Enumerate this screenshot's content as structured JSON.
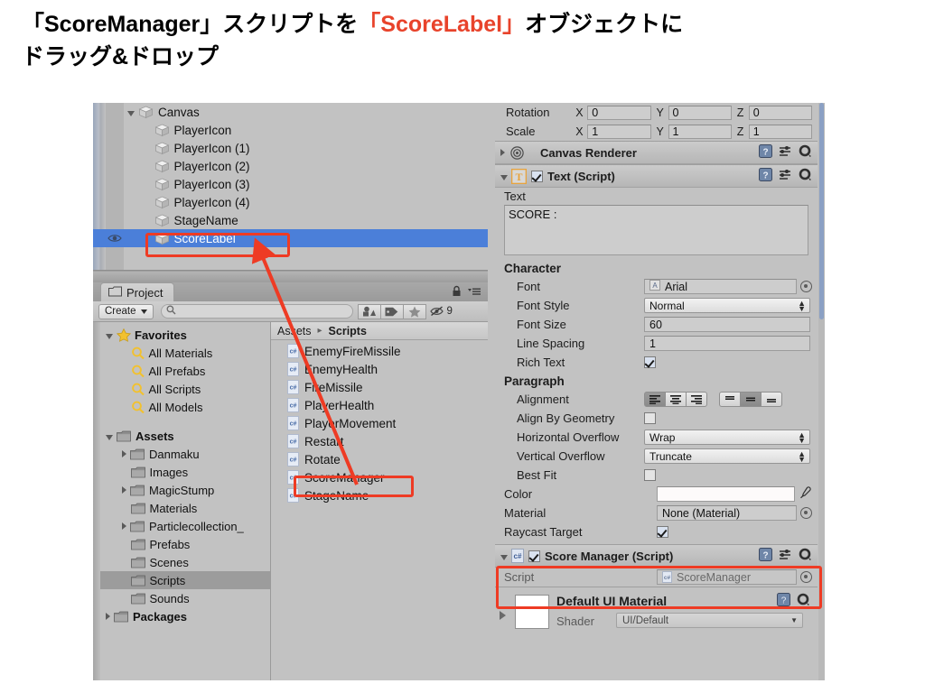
{
  "caption": {
    "line1_pre": "「ScoreManager」スクリプトを",
    "line1_hl": "「ScoreLabel」",
    "line1_post": "オブジェクトに",
    "line2": "ドラッグ&ドロップ"
  },
  "hierarchy": {
    "items": [
      {
        "label": "Canvas",
        "indent": 1,
        "expanded": true,
        "selected": false,
        "eye": false
      },
      {
        "label": "PlayerIcon",
        "indent": 2,
        "expanded": false,
        "selected": false,
        "eye": false
      },
      {
        "label": "PlayerIcon (1)",
        "indent": 2,
        "expanded": false,
        "selected": false,
        "eye": false
      },
      {
        "label": "PlayerIcon (2)",
        "indent": 2,
        "expanded": false,
        "selected": false,
        "eye": false
      },
      {
        "label": "PlayerIcon (3)",
        "indent": 2,
        "expanded": false,
        "selected": false,
        "eye": false
      },
      {
        "label": "PlayerIcon (4)",
        "indent": 2,
        "expanded": false,
        "selected": false,
        "eye": false
      },
      {
        "label": "StageName",
        "indent": 2,
        "expanded": false,
        "selected": false,
        "eye": false
      },
      {
        "label": "ScoreLabel",
        "indent": 2,
        "expanded": false,
        "selected": true,
        "eye": true
      }
    ]
  },
  "project": {
    "tab_label": "Project",
    "create_label": "Create",
    "search_placeholder": "",
    "hidden_count": "9",
    "breadcrumb": {
      "root": "Assets",
      "current": "Scripts"
    },
    "tree": [
      {
        "label": "Favorites",
        "kind": "favorites",
        "indent": 0,
        "expanded": true,
        "bold": true,
        "selected": false
      },
      {
        "label": "All Materials",
        "kind": "search",
        "indent": 1,
        "expanded": null,
        "bold": false,
        "selected": false
      },
      {
        "label": "All Prefabs",
        "kind": "search",
        "indent": 1,
        "expanded": null,
        "bold": false,
        "selected": false
      },
      {
        "label": "All Scripts",
        "kind": "search",
        "indent": 1,
        "expanded": null,
        "bold": false,
        "selected": false
      },
      {
        "label": "All Models",
        "kind": "search",
        "indent": 1,
        "expanded": null,
        "bold": false,
        "selected": false
      },
      {
        "label": "",
        "kind": "spacer",
        "indent": 0,
        "expanded": null,
        "bold": false,
        "selected": false
      },
      {
        "label": "Assets",
        "kind": "folder",
        "indent": 0,
        "expanded": true,
        "bold": true,
        "selected": false
      },
      {
        "label": "Danmaku",
        "kind": "folder",
        "indent": 1,
        "expanded": false,
        "bold": false,
        "selected": false
      },
      {
        "label": "Images",
        "kind": "folder",
        "indent": 1,
        "expanded": null,
        "bold": false,
        "selected": false
      },
      {
        "label": "MagicStump",
        "kind": "folder",
        "indent": 1,
        "expanded": false,
        "bold": false,
        "selected": false
      },
      {
        "label": "Materials",
        "kind": "folder",
        "indent": 1,
        "expanded": null,
        "bold": false,
        "selected": false
      },
      {
        "label": "Particlecollection_",
        "kind": "folder",
        "indent": 1,
        "expanded": false,
        "bold": false,
        "selected": false
      },
      {
        "label": "Prefabs",
        "kind": "folder",
        "indent": 1,
        "expanded": null,
        "bold": false,
        "selected": false
      },
      {
        "label": "Scenes",
        "kind": "folder",
        "indent": 1,
        "expanded": null,
        "bold": false,
        "selected": false
      },
      {
        "label": "Scripts",
        "kind": "folder",
        "indent": 1,
        "expanded": null,
        "bold": false,
        "selected": true
      },
      {
        "label": "Sounds",
        "kind": "folder",
        "indent": 1,
        "expanded": null,
        "bold": false,
        "selected": false
      },
      {
        "label": "Packages",
        "kind": "folder",
        "indent": 0,
        "expanded": false,
        "bold": true,
        "selected": false
      }
    ],
    "assets": [
      {
        "label": "EnemyFireMissile",
        "type": "cs"
      },
      {
        "label": "EnemyHealth",
        "type": "cs"
      },
      {
        "label": "FireMissile",
        "type": "cs"
      },
      {
        "label": "PlayerHealth",
        "type": "cs"
      },
      {
        "label": "PlayerMovement",
        "type": "cs"
      },
      {
        "label": "Restart",
        "type": "cs"
      },
      {
        "label": "Rotate",
        "type": "cs"
      },
      {
        "label": "ScoreManager",
        "type": "cs"
      },
      {
        "label": "StageName",
        "type": "cs"
      }
    ]
  },
  "inspector": {
    "transform": {
      "rotation_label": "Rotation",
      "rotation": {
        "x": "0",
        "y": "0",
        "z": "0"
      },
      "scale_label": "Scale",
      "scale": {
        "x": "1",
        "y": "1",
        "z": "1"
      },
      "axis_x": "X",
      "axis_y": "Y",
      "axis_z": "Z"
    },
    "canvas_renderer": {
      "title": "Canvas Renderer"
    },
    "text_component": {
      "title": "Text (Script)",
      "enabled": true,
      "text_label": "Text",
      "text_value": "SCORE :",
      "character_label": "Character",
      "font_label": "Font",
      "font_value": "Arial",
      "font_style_label": "Font Style",
      "font_style_value": "Normal",
      "font_size_label": "Font Size",
      "font_size_value": "60",
      "line_spacing_label": "Line Spacing",
      "line_spacing_value": "1",
      "rich_text_label": "Rich Text",
      "rich_text_checked": true,
      "paragraph_label": "Paragraph",
      "alignment_label": "Alignment",
      "alignment_h_selected": 0,
      "alignment_v_selected": 1,
      "align_by_geometry_label": "Align By Geometry",
      "align_by_geometry_checked": false,
      "horizontal_overflow_label": "Horizontal Overflow",
      "horizontal_overflow_value": "Wrap",
      "vertical_overflow_label": "Vertical Overflow",
      "vertical_overflow_value": "Truncate",
      "best_fit_label": "Best Fit",
      "best_fit_checked": false,
      "color_label": "Color",
      "color_value": "#FFFFFF",
      "material_label": "Material",
      "material_value": "None (Material)",
      "raycast_target_label": "Raycast Target",
      "raycast_target_checked": true
    },
    "score_manager_component": {
      "title": "Score Manager (Script)",
      "enabled": true,
      "script_label": "Script",
      "script_value": "ScoreManager"
    },
    "material_block": {
      "name": "Default UI Material",
      "shader_label": "Shader",
      "shader_value": "UI/Default"
    }
  },
  "colors": {
    "accent_red": "#EE3B24",
    "selection_blue": "#4B7FD9",
    "panel_bg": "#C2C2C2"
  }
}
